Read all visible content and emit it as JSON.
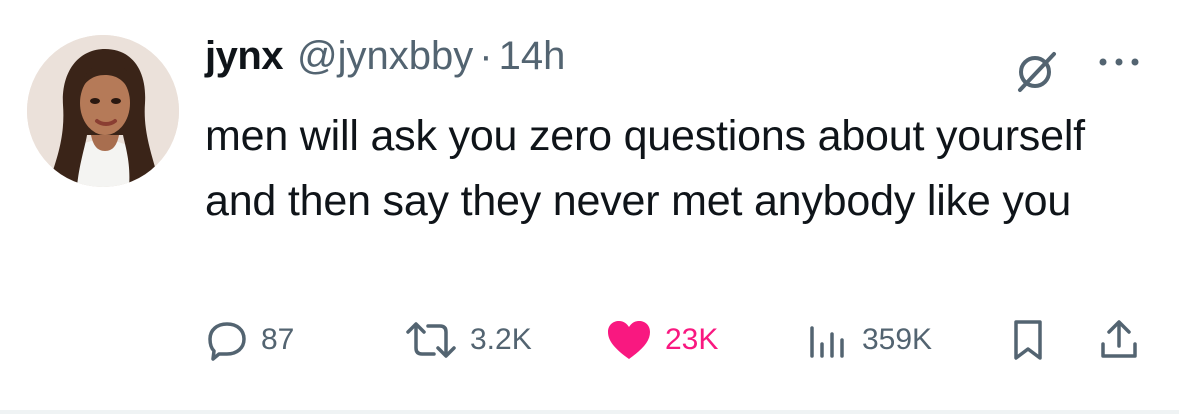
{
  "tweet": {
    "author": {
      "display_name": "jynx",
      "handle": "@jynxbby"
    },
    "separator": "·",
    "timestamp": "14h",
    "text": "men will ask you zero questions about yourself and then say they never met anybody like you"
  },
  "actions": {
    "replies": "87",
    "retweets": "3.2K",
    "likes": "23K",
    "views": "359K",
    "liked": true
  },
  "icons": {
    "reply": "reply-bubble-icon",
    "retweet": "retweet-icon",
    "like": "heart-icon",
    "views": "views-bar-chart-icon",
    "bookmark": "bookmark-icon",
    "share": "share-icon",
    "grok": "grok-icon",
    "more": "more-dots-icon"
  },
  "colors": {
    "text_primary": "#0f1419",
    "text_secondary": "#536471",
    "like_active": "#f91880",
    "background": "#ffffff"
  }
}
